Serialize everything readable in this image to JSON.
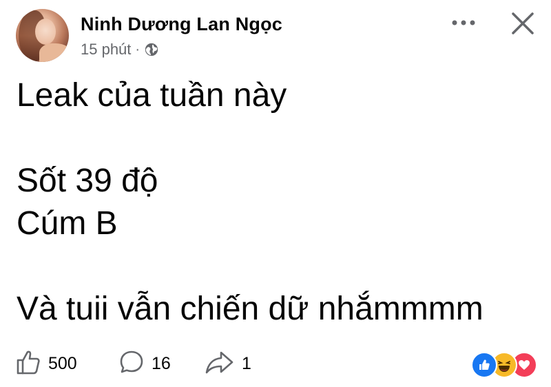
{
  "author": {
    "name": "Ninh Dương Lan Ngọc",
    "avatar_icon": "profile-photo"
  },
  "meta": {
    "time": "15 phút",
    "separator": "·",
    "privacy_icon": "globe-icon"
  },
  "header_actions": {
    "more_icon": "more-horizontal-icon",
    "close_icon": "close-icon"
  },
  "post": {
    "lines": [
      "Leak của tuần này",
      "",
      "Sốt 39 độ",
      "Cúm B",
      "",
      "Và tuii vẫn chiến dữ nhắmmmm"
    ]
  },
  "footer": {
    "likes": "500",
    "comments": "16",
    "shares": "1",
    "reactions": [
      "like",
      "haha",
      "love"
    ],
    "colors": {
      "like": "#1877f2",
      "haha": "#f7b928",
      "love": "#f33e58"
    }
  }
}
